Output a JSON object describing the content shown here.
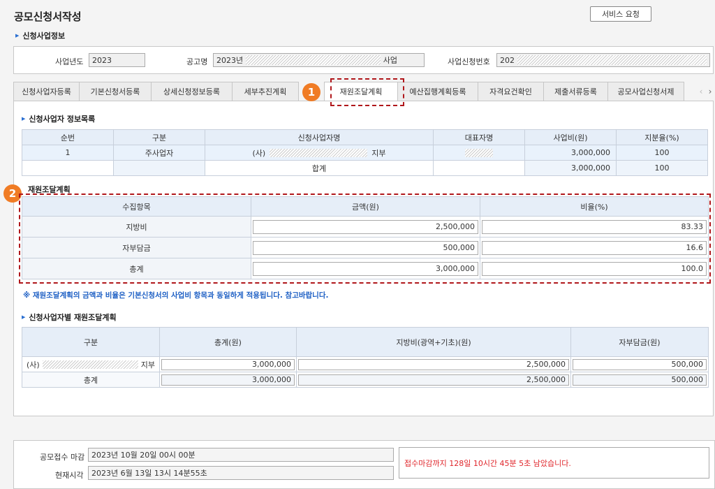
{
  "header": {
    "title": "공모신청서작성",
    "service_button": "서비스 요청"
  },
  "section_info": {
    "title": "신청사업정보",
    "year_label": "사업년도",
    "year_value": "2023",
    "notice_label": "공고명",
    "notice_value_prefix": "2023년",
    "notice_value_suffix": "사업",
    "app_no_label": "사업신청번호",
    "app_no_value": "202"
  },
  "tabs": {
    "items": [
      "신청사업자등록",
      "기본신청서등록",
      "상세신청정보등록",
      "세부추진계획",
      "재원조달계획",
      "예산집행계획등록",
      "자격요건확인",
      "제출서류등록",
      "공모사업신청서제"
    ],
    "active": "재원조달계획",
    "prev": "‹",
    "next": "›"
  },
  "applicants": {
    "title": "신청사업자 정보목록",
    "headers": [
      "순번",
      "구분",
      "신청사업자명",
      "대표자명",
      "사업비(원)",
      "지분율(%)"
    ],
    "row": {
      "no": "1",
      "type": "주사업자",
      "name_prefix": "(사)",
      "name_suffix": "지부",
      "rep": "",
      "cost": "3,000,000",
      "share": "100"
    },
    "total": {
      "label": "합계",
      "cost": "3,000,000",
      "share": "100"
    }
  },
  "funding": {
    "title": "재원조달계획",
    "headers": [
      "수집항목",
      "금액(원)",
      "비율(%)"
    ],
    "rows": [
      {
        "item": "지방비",
        "amount": "2,500,000",
        "ratio": "83.33"
      },
      {
        "item": "자부담금",
        "amount": "500,000",
        "ratio": "16.6"
      },
      {
        "item": "총계",
        "amount": "3,000,000",
        "ratio": "100.0"
      }
    ],
    "note": "※ 재원조달계획의 금액과 비율은 기본신청서의 사업비 항목과 동일하게 적용됩니다. 참고바랍니다."
  },
  "by_applicant": {
    "title": "신청사업자별 재원조달계획",
    "headers": [
      "구분",
      "총계(원)",
      "지방비(광역+기초)(원)",
      "자부담금(원)"
    ],
    "row": {
      "name_prefix": "(사)",
      "name_suffix": "지부",
      "total": "3,000,000",
      "local": "2,500,000",
      "self": "500,000"
    },
    "sum": {
      "label": "총계",
      "total": "3,000,000",
      "local": "2,500,000",
      "self": "500,000"
    }
  },
  "deadline": {
    "close_label": "공모접수 마감",
    "close_value": "2023년 10월 20일 00시 00분",
    "now_label": "현재시각",
    "now_value": "2023년 6월 13일 13시 14분55초",
    "remaining": "접수마감까지 128일 10시간 45분 5초 남았습니다."
  },
  "callouts": [
    "1",
    "2"
  ],
  "colors": {
    "accent": "#2a6fd1",
    "callout": "#f07c25",
    "highlight": "#b0171b",
    "note": "#1d5fc4",
    "remaining": "#e0262b"
  }
}
